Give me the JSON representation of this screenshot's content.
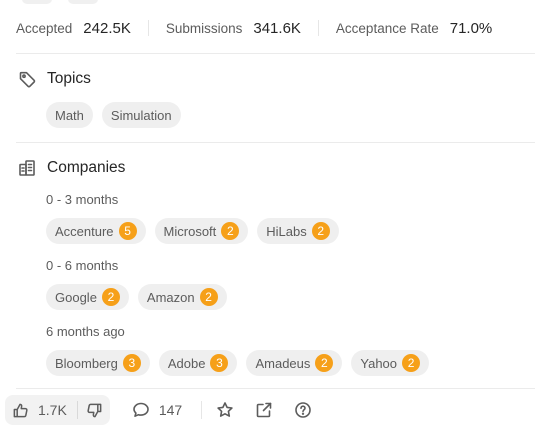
{
  "stats": {
    "accepted": {
      "label": "Accepted",
      "value": "242.5K"
    },
    "submissions": {
      "label": "Submissions",
      "value": "341.6K"
    },
    "acceptance_rate": {
      "label": "Acceptance Rate",
      "value": "71.0%"
    }
  },
  "topics": {
    "title": "Topics",
    "icon": "tag-icon",
    "items": [
      "Math",
      "Simulation"
    ]
  },
  "companies": {
    "title": "Companies",
    "icon": "building-icon",
    "groups": [
      {
        "period": "0 - 3 months",
        "items": [
          {
            "name": "Accenture",
            "count": "5"
          },
          {
            "name": "Microsoft",
            "count": "2"
          },
          {
            "name": "HiLabs",
            "count": "2"
          }
        ]
      },
      {
        "period": "0 - 6 months",
        "items": [
          {
            "name": "Google",
            "count": "2"
          },
          {
            "name": "Amazon",
            "count": "2"
          }
        ]
      },
      {
        "period": "6 months ago",
        "items": [
          {
            "name": "Bloomberg",
            "count": "3"
          },
          {
            "name": "Adobe",
            "count": "3"
          },
          {
            "name": "Amadeus",
            "count": "2"
          },
          {
            "name": "Yahoo",
            "count": "2"
          }
        ]
      }
    ]
  },
  "footer": {
    "likes": "1.7K",
    "comments": "147",
    "icons": [
      "thumbs-up-icon",
      "thumbs-down-icon",
      "comment-icon",
      "star-icon",
      "share-icon",
      "help-icon"
    ]
  },
  "colors": {
    "badge": "#f6a019",
    "chip_bg": "#efefef",
    "text_muted": "#5c5c5c"
  }
}
